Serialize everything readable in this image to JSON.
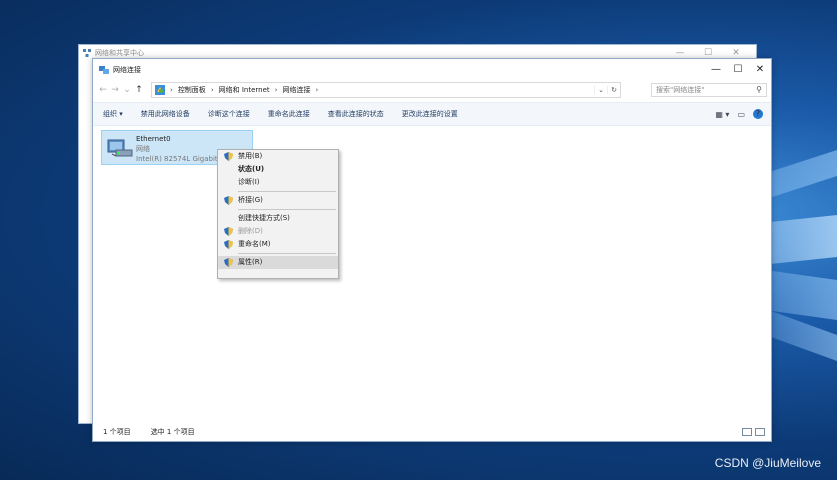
{
  "back_window": {
    "title": "网络和共享中心",
    "controls": [
      "—",
      "☐",
      "✕"
    ]
  },
  "window": {
    "title": "网络连接",
    "controls": [
      "—",
      "☐",
      "✕"
    ]
  },
  "address": {
    "nav": [
      "←",
      "→",
      "⌄",
      "↑"
    ],
    "breadcrumbs": [
      "控制面板",
      "网络和 Internet",
      "网络连接"
    ],
    "dropdown": "⌄",
    "refresh": "↻",
    "search_placeholder": "搜索\"网络连接\""
  },
  "toolbar": {
    "items": [
      "组织 ▾",
      "禁用此网络设备",
      "诊断这个连接",
      "重命名此连接",
      "查看此连接的状态",
      "更改此连接的设置"
    ],
    "help": "?"
  },
  "adapter": {
    "name": "Ethernet0",
    "network": "网络",
    "device": "Intel(R) 82574L Gigabit"
  },
  "context_menu": {
    "items": [
      {
        "label": "禁用(B)",
        "shield": true
      },
      {
        "label": "状态(U)",
        "bold": true
      },
      {
        "label": "诊断(I)"
      },
      {
        "label": "桥接(G)",
        "shield": true
      },
      {
        "label": "创建快捷方式(S)"
      },
      {
        "label": "删除(D)",
        "shield": true,
        "disabled": true
      },
      {
        "label": "重命名(M)",
        "shield": true
      },
      {
        "label": "属性(R)",
        "shield": true,
        "highlighted": true
      }
    ]
  },
  "status": {
    "count": "1 个项目",
    "selected": "选中 1 个项目"
  },
  "watermark": "CSDN @JiuMeilove"
}
